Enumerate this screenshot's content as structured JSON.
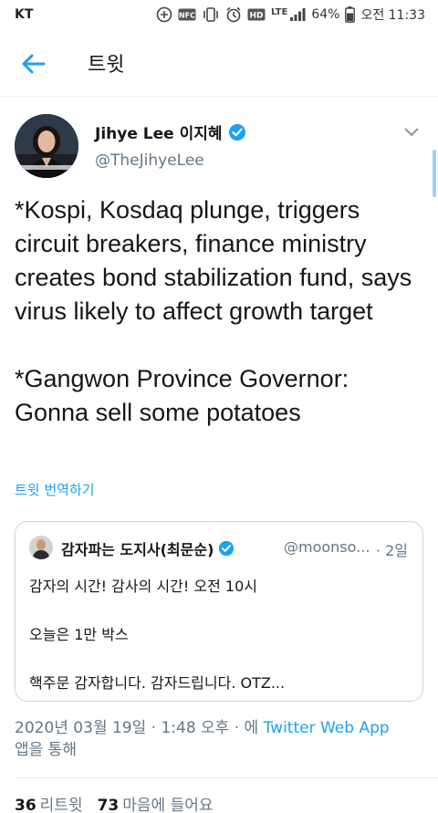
{
  "status_bar": {
    "carrier": "KT",
    "lte_label": "LTE",
    "battery": "64%",
    "time": "오전 11:33"
  },
  "nav": {
    "title": "트윗",
    "back_icon": "arrow-left-icon"
  },
  "author": {
    "name": "Jihye Lee 이지혜",
    "handle": "@TheJihyeLee",
    "verified": true
  },
  "tweet": {
    "line1": "*Kospi, Kosdaq plunge, triggers circuit breakers, finance ministry creates bond stabilization fund, says virus likely to affect growth target",
    "line2": "*Gangwon Province Governor: Gonna sell some potatoes",
    "translate_label": "트윗 번역하기"
  },
  "quote": {
    "name": "감자파는 도지사(최문순)",
    "handle": "@moonso...",
    "time": "· 2일",
    "lines": [
      "감자의 시간! 감사의 시간!  오전 10시",
      "오늘은 1만 박스",
      "핵주문 감자합니다. 감자드립니다. OTZ..."
    ]
  },
  "meta": {
    "timestamp": "2020년 03월 19일 · 1:48 오후 · 에",
    "via": "Twitter Web App",
    "suffix": "앱을 통해"
  },
  "stats": {
    "retweets_count": "36",
    "retweets_label": "리트윗",
    "likes_count": "73",
    "likes_label": "마음에 들어요"
  },
  "colors": {
    "accent": "#1da1f2",
    "text": "#14171a",
    "secondary": "#657786",
    "border": "#ccd6dd"
  }
}
